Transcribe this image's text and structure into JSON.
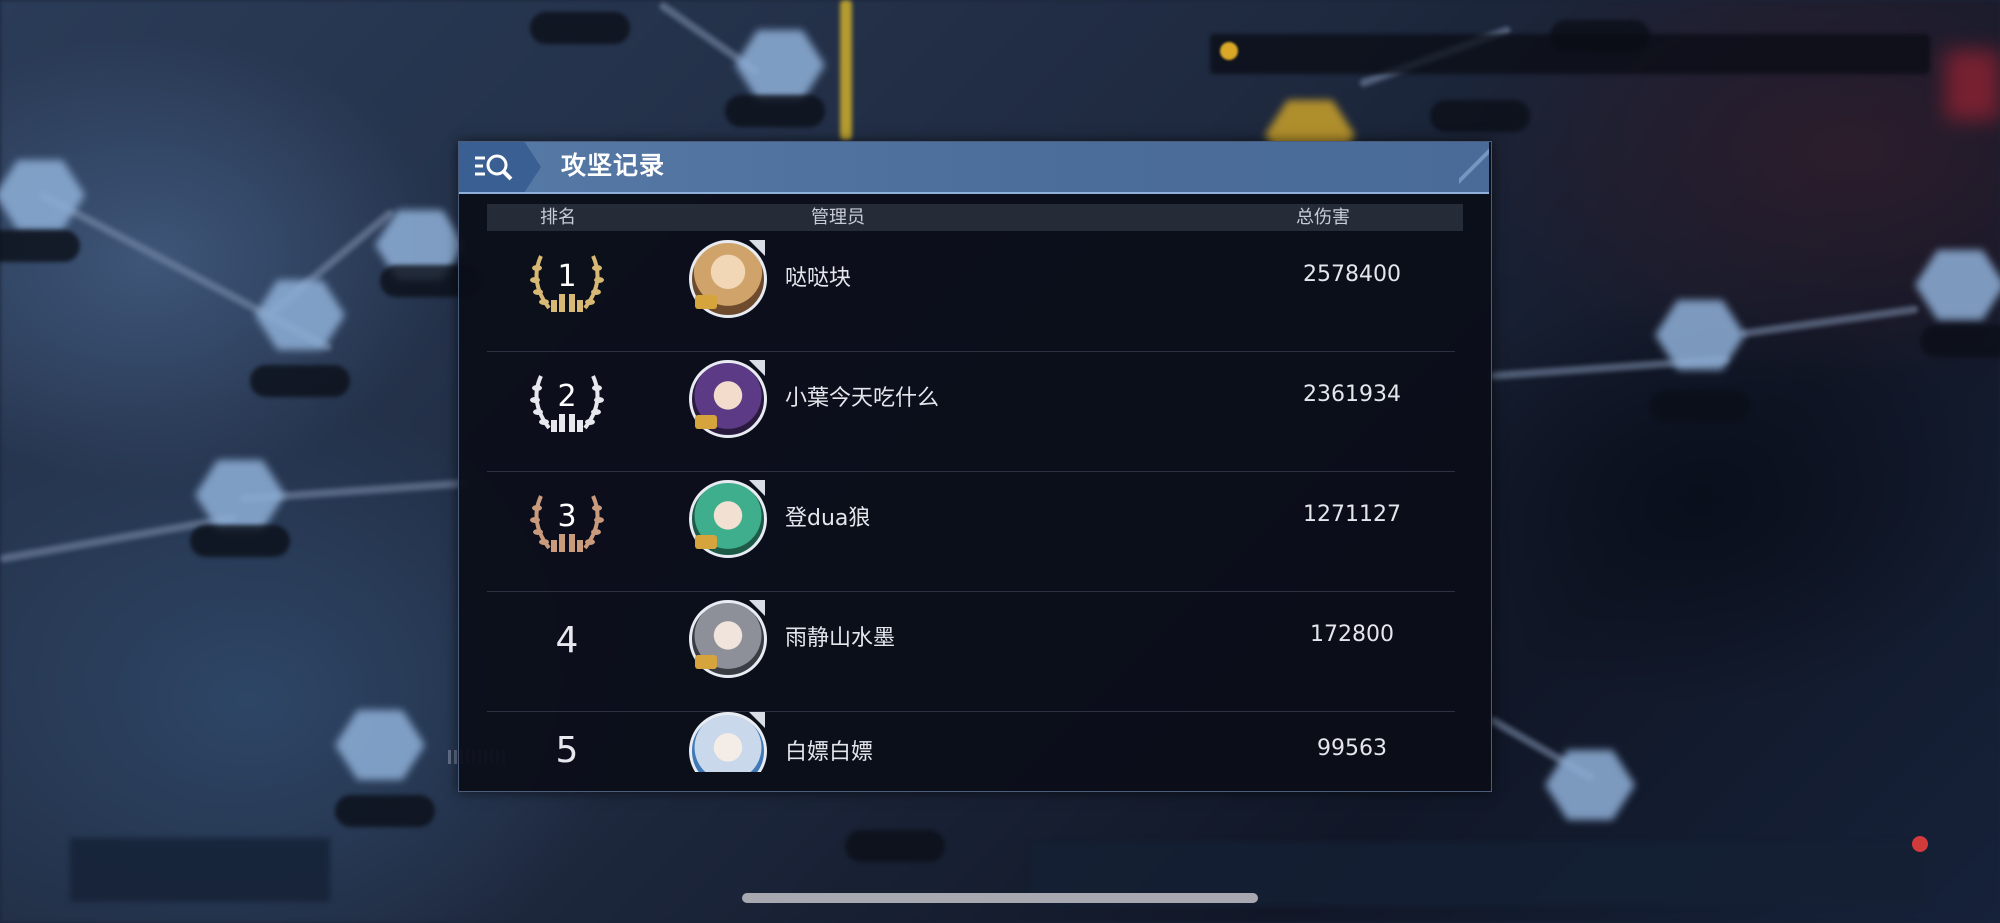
{
  "panel": {
    "title": "攻坚记录",
    "search_icon": "search-list-icon"
  },
  "table": {
    "headers": {
      "rank": "排名",
      "manager": "管理员",
      "damage": "总伤害"
    },
    "rows": [
      {
        "rank": "1",
        "badge": "gold-laurel",
        "name": "哒哒块",
        "damage": "2578400",
        "avatar_color": "#d9b98a"
      },
      {
        "rank": "2",
        "badge": "silver-laurel",
        "name": "小葉今天吃什么",
        "damage": "2361934",
        "avatar_color": "#5d3a86"
      },
      {
        "rank": "3",
        "badge": "bronze-laurel",
        "name": "登dua狼",
        "damage": "1271127",
        "avatar_color": "#3fae8c"
      },
      {
        "rank": "4",
        "badge": "",
        "name": "雨静山水墨",
        "damage": "172800",
        "avatar_color": "#8d9098"
      },
      {
        "rank": "5",
        "badge": "",
        "name": "白嫖白嫖",
        "damage": "99563",
        "avatar_color": "#c9d8ea"
      }
    ]
  },
  "colors": {
    "gold": "#d7b874",
    "silver": "#e6e8ee",
    "bronze": "#c99a7c",
    "titlebar": "#5679a6"
  }
}
